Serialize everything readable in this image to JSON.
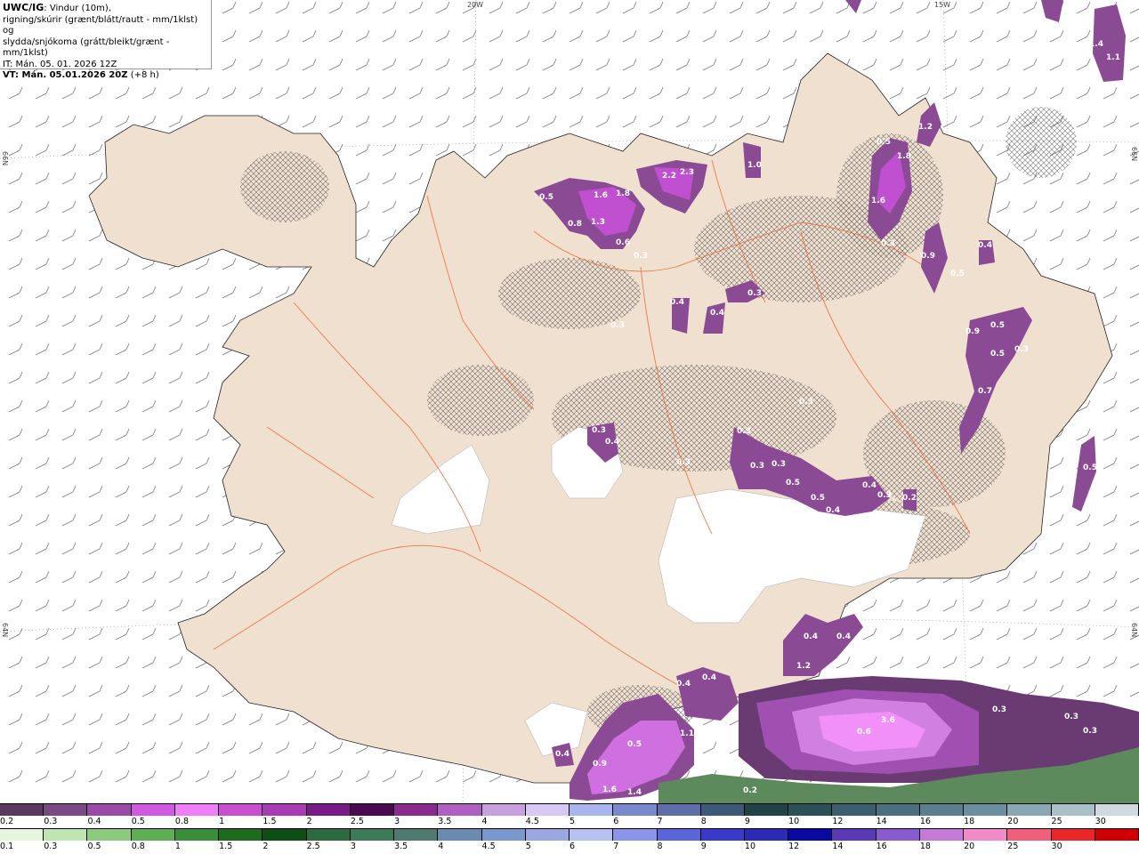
{
  "header": {
    "product": "UWC/IG",
    "line1_rest": ": Vindur (10m),",
    "line2": "rigning/skúrir (grænt/blátt/rautt - mm/1klst) og",
    "line3": "slydda/snjókoma (grátt/bleikt/grænt - mm/1klst)",
    "it_line": "IT: Mán. 05. 01. 2026 12Z",
    "vt_bold": "VT: Mán. 05.01.2026 20Z",
    "vt_rest": " (+8 h)"
  },
  "graticule": {
    "top_labels": [
      "20W",
      "15W"
    ],
    "side_labels": [
      "66N",
      "65N",
      "64N"
    ]
  },
  "precip_labels": [
    "0.5",
    "1.6",
    "1.8",
    "1.3",
    "0.8",
    "0.6",
    "0.3",
    "2.2",
    "2.3",
    "1.0",
    "0.5",
    "1.8",
    "1.2",
    "1.6",
    "0.3",
    "0.9",
    "0.5",
    "0.4",
    "1.4",
    "1.1",
    "0.3",
    "0.4",
    "0.4",
    "0.3",
    "0.3",
    "0.4",
    "0.9",
    "0.5",
    "0.5",
    "0.7",
    "0.3",
    "0.3",
    "0.3",
    "0.3",
    "0.4",
    "0.5",
    "0.3",
    "0.4",
    "0.3",
    "0.3",
    "0.2",
    "0.5",
    "0.4",
    "0.4",
    "1.2",
    "0.4",
    "0.4",
    "0.5",
    "1.1",
    "0.9",
    "0.4",
    "1.6",
    "1.4",
    "0.2",
    "0.2",
    "0.6",
    "3.6",
    "0.3",
    "0.3",
    "0.3",
    "0.5"
  ],
  "scale_snow": {
    "labels": [
      "0.2",
      "0.3",
      "0.4",
      "0.5",
      "0.8",
      "1",
      "1.5",
      "2",
      "2.5",
      "3",
      "3.5",
      "4",
      "4.5",
      "5",
      "6",
      "7",
      "8",
      "9",
      "10",
      "12",
      "14",
      "16",
      "18",
      "20",
      "25",
      "30"
    ],
    "colors": [
      "#5a3a5e",
      "#7a4a84",
      "#9a4aa8",
      "#cf5adf",
      "#f07ef8",
      "#c850d0",
      "#a83ab4",
      "#7a1a86",
      "#4a0a52",
      "#8a2a8e",
      "#b060c0",
      "#c7a0e0",
      "#d8c8f4",
      "#aab4ee",
      "#7a88cc",
      "#5e6ea8",
      "#3c5a78",
      "#1e4448",
      "#2a5058",
      "#3a6070",
      "#4a7080",
      "#5a8090",
      "#6a90a0",
      "#8aa8b4",
      "#aac0c8",
      "#d0d8e0"
    ]
  },
  "scale_rain": {
    "labels": [
      "0.1",
      "0.3",
      "0.5",
      "0.8",
      "1",
      "1.5",
      "2",
      "2.5",
      "3",
      "3.5",
      "4",
      "4.5",
      "5",
      "6",
      "7",
      "8",
      "9",
      "10",
      "12",
      "14",
      "16",
      "18",
      "20",
      "25",
      "30"
    ],
    "colors": [
      "#e6f5e0",
      "#bfe5b0",
      "#8ccb7e",
      "#5eae56",
      "#3a8e3a",
      "#1e6a1e",
      "#0e4e14",
      "#2e6a40",
      "#3e7a58",
      "#507a70",
      "#6a8ab0",
      "#7a98cc",
      "#9aa8e0",
      "#b8c0f0",
      "#8a94e8",
      "#5a66d8",
      "#3a3ac8",
      "#2a2ab4",
      "#0a0aa0",
      "#5a3ab4",
      "#8a5ad0",
      "#c47ad8",
      "#f08ac8",
      "#f0607a",
      "#e82828",
      "#d00000"
    ]
  }
}
